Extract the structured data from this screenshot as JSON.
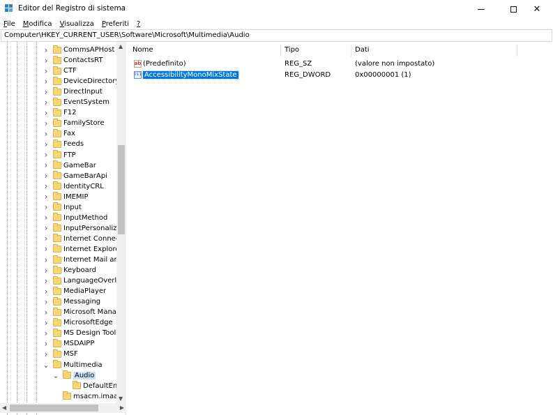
{
  "window": {
    "title": "Editor del Registro di sistema",
    "minimize_icon": "minimize-icon",
    "maximize_icon": "maximize-icon",
    "close_glyph": "✕"
  },
  "menu": {
    "items": [
      {
        "accel": "F",
        "rest": "ile"
      },
      {
        "accel": "M",
        "rest": "odifica"
      },
      {
        "accel": "V",
        "rest": "isualizza"
      },
      {
        "accel": "P",
        "rest": "referiti"
      },
      {
        "accel": "?",
        "rest": ""
      }
    ]
  },
  "address": {
    "path": "Computer\\HKEY_CURRENT_USER\\Software\\Microsoft\\Multimedia\\Audio"
  },
  "tree": {
    "items": [
      {
        "label": "CommsAPHost",
        "state": "collapsed"
      },
      {
        "label": "ContactsRT",
        "state": "collapsed"
      },
      {
        "label": "CTF",
        "state": "collapsed"
      },
      {
        "label": "DeviceDirectory",
        "state": "collapsed"
      },
      {
        "label": "DirectInput",
        "state": "collapsed"
      },
      {
        "label": "EventSystem",
        "state": "collapsed"
      },
      {
        "label": "F12",
        "state": "collapsed"
      },
      {
        "label": "FamilyStore",
        "state": "collapsed"
      },
      {
        "label": "Fax",
        "state": "collapsed"
      },
      {
        "label": "Feeds",
        "state": "collapsed"
      },
      {
        "label": "FTP",
        "state": "collapsed"
      },
      {
        "label": "GameBar",
        "state": "collapsed"
      },
      {
        "label": "GameBarApi",
        "state": "collapsed"
      },
      {
        "label": "IdentityCRL",
        "state": "collapsed"
      },
      {
        "label": "IMEMIP",
        "state": "collapsed"
      },
      {
        "label": "Input",
        "state": "collapsed"
      },
      {
        "label": "InputMethod",
        "state": "collapsed"
      },
      {
        "label": "InputPersonalizat",
        "state": "collapsed"
      },
      {
        "label": "Internet Connecti",
        "state": "collapsed"
      },
      {
        "label": "Internet Explorer",
        "state": "collapsed"
      },
      {
        "label": "Internet Mail and",
        "state": "collapsed"
      },
      {
        "label": "Keyboard",
        "state": "collapsed"
      },
      {
        "label": "LanguageOverlay",
        "state": "collapsed"
      },
      {
        "label": "MediaPlayer",
        "state": "collapsed"
      },
      {
        "label": "Messaging",
        "state": "collapsed"
      },
      {
        "label": "Microsoft Manag",
        "state": "collapsed"
      },
      {
        "label": "MicrosoftEdge",
        "state": "collapsed"
      },
      {
        "label": "MS Design Tools",
        "state": "collapsed"
      },
      {
        "label": "MSDAIPP",
        "state": "collapsed"
      },
      {
        "label": "MSF",
        "state": "collapsed"
      },
      {
        "label": "Multimedia",
        "state": "expanded"
      },
      {
        "label": "Audio",
        "state": "expanded",
        "selected": true
      },
      {
        "label": "DefaultEnd",
        "state": "leaf"
      },
      {
        "label": "msacm.imaad",
        "state": "leaf"
      }
    ]
  },
  "list": {
    "headers": {
      "name": "Nome",
      "type": "Tipo",
      "data": "Dati"
    },
    "rows": [
      {
        "icon": "ab",
        "name": "(Predefinito)",
        "type": "REG_SZ",
        "data": "(valore non impostato)",
        "selected": false
      },
      {
        "icon": "011",
        "name": "AccessibilityMonoMixState",
        "type": "REG_DWORD",
        "data": "0x00000001 (1)",
        "selected": true
      }
    ]
  }
}
